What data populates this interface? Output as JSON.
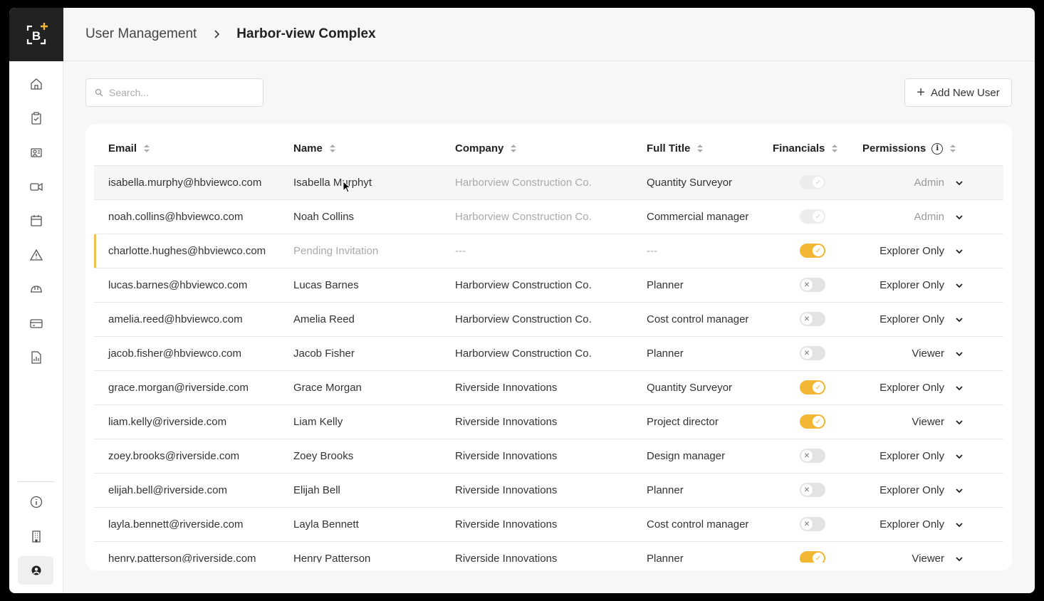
{
  "header": {
    "breadcrumb_root": "User Management",
    "breadcrumb_current": "Harbor-view Complex"
  },
  "sidebar": {
    "logo_text": "B",
    "items": [
      {
        "icon": "home-icon"
      },
      {
        "icon": "clipboard-check-icon"
      },
      {
        "icon": "user-card-icon"
      },
      {
        "icon": "video-camera-icon"
      },
      {
        "icon": "calendar-icon"
      },
      {
        "icon": "warning-icon"
      },
      {
        "icon": "hard-hat-icon"
      },
      {
        "icon": "credit-card-icon"
      },
      {
        "icon": "report-chart-icon"
      }
    ],
    "bottom_items": [
      {
        "icon": "info-icon"
      },
      {
        "icon": "building-icon"
      },
      {
        "icon": "user-account-icon"
      }
    ]
  },
  "search": {
    "placeholder": "Search...",
    "value": ""
  },
  "add_button": {
    "label": "Add New User"
  },
  "table": {
    "columns": {
      "email": "Email",
      "name": "Name",
      "company": "Company",
      "title": "Full Title",
      "financials": "Financials",
      "permissions": "Permissions"
    },
    "rows": [
      {
        "email": "isabella.murphy@hbviewco.com",
        "name": "Isabella Murphyt",
        "company": "Harborview Construction Co.",
        "title": "Quantity Surveyor",
        "financials": "disabled",
        "permission": "Admin"
      },
      {
        "email": "noah.collins@hbviewco.com",
        "name": "Noah Collins",
        "company": "Harborview Construction Co.",
        "title": "Commercial manager",
        "financials": "disabled",
        "permission": "Admin"
      },
      {
        "email": "charlotte.hughes@hbviewco.com",
        "name": "Pending Invitation",
        "company": "---",
        "title": "---",
        "financials": "on",
        "permission": "Explorer Only"
      },
      {
        "email": "lucas.barnes@hbviewco.com",
        "name": "Lucas Barnes",
        "company": "Harborview Construction Co.",
        "title": "Planner",
        "financials": "off",
        "permission": "Explorer Only"
      },
      {
        "email": "amelia.reed@hbviewco.com",
        "name": "Amelia Reed",
        "company": "Harborview Construction Co.",
        "title": "Cost control manager",
        "financials": "off",
        "permission": "Explorer Only"
      },
      {
        "email": "jacob.fisher@hbviewco.com",
        "name": "Jacob Fisher",
        "company": "Harborview Construction Co.",
        "title": "Planner",
        "financials": "off",
        "permission": "Viewer"
      },
      {
        "email": "grace.morgan@riverside.com",
        "name": "Grace Morgan",
        "company": "Riverside Innovations",
        "title": "Quantity Surveyor",
        "financials": "on",
        "permission": "Explorer Only"
      },
      {
        "email": "liam.kelly@riverside.com",
        "name": "Liam Kelly",
        "company": "Riverside Innovations",
        "title": "Project director",
        "financials": "on",
        "permission": "Viewer"
      },
      {
        "email": "zoey.brooks@riverside.com",
        "name": "Zoey Brooks",
        "company": "Riverside Innovations",
        "title": "Design manager",
        "financials": "off",
        "permission": "Explorer Only"
      },
      {
        "email": "elijah.bell@riverside.com",
        "name": "Elijah Bell",
        "company": "Riverside Innovations",
        "title": "Planner",
        "financials": "off",
        "permission": "Explorer Only"
      },
      {
        "email": "layla.bennett@riverside.com",
        "name": "Layla Bennett",
        "company": "Riverside Innovations",
        "title": "Cost control manager",
        "financials": "off",
        "permission": "Explorer Only"
      },
      {
        "email": "henry.patterson@riverside.com",
        "name": "Henry Patterson",
        "company": "Riverside Innovations",
        "title": "Planner",
        "financials": "on",
        "permission": "Viewer"
      }
    ]
  },
  "colors": {
    "accent": "#f2b733",
    "sidebar_logo_bg": "#222222",
    "pending_marker": "#f2c14e"
  }
}
